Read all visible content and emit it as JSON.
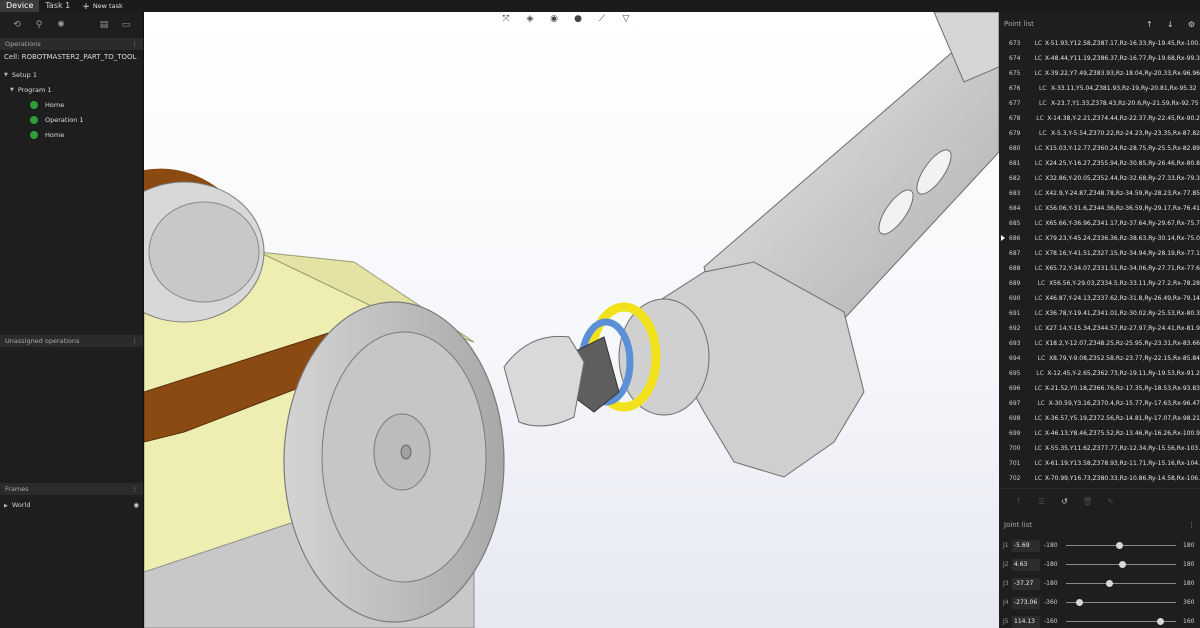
{
  "topbar": {
    "tabs": [
      {
        "label": "Device"
      },
      {
        "label": "Task 1"
      }
    ],
    "new_task": "New task"
  },
  "left": {
    "operations_title": "Operations",
    "cell": "Cell: ROBOTMASTER2_PART_TO_TOOL",
    "setup": "Setup 1",
    "program": "Program 1",
    "items": [
      "Home",
      "Operation 1",
      "Home"
    ],
    "unassigned_title": "Unassigned operations",
    "frames_title": "Frames",
    "frames_item": "World"
  },
  "points": {
    "title": "Point list",
    "current": "686",
    "rows": [
      {
        "n": "673",
        "t": "LC",
        "c": "X-51.93,Y12.58,Z387.17,Rz-16.33,Ry-19.45,Rx-100."
      },
      {
        "n": "674",
        "t": "LC",
        "c": "X-48.44,Y11.19,Z386.37,Rz-16.77,Ry-19.68,Rx-99.3"
      },
      {
        "n": "675",
        "t": "LC",
        "c": "X-39.22,Y7.49,Z383.93,Rz-18.04,Ry-20.33,Rx-96.96"
      },
      {
        "n": "676",
        "t": "LC",
        "c": "X-33.11,Y5.04,Z381.93,Rz-19,Ry-20.81,Rx-95.32"
      },
      {
        "n": "677",
        "t": "LC",
        "c": "X-23.7,Y1.33,Z378.43,Rz-20.6,Ry-21.59,Rx-92.75"
      },
      {
        "n": "678",
        "t": "LC",
        "c": "X-14.38,Y-2.21,Z374.44,Rz-22.37,Ry-22.45,Rx-90.2"
      },
      {
        "n": "679",
        "t": "LC",
        "c": "X-5.3,Y-5.54,Z370.22,Rz-24.23,Ry-23.35,Rx-87.82"
      },
      {
        "n": "680",
        "t": "LC",
        "c": "X15.03,Y-12.77,Z360.24,Rz-28.75,Ry-25.5,Rx-82.89"
      },
      {
        "n": "681",
        "t": "LC",
        "c": "X24.25,Y-16.27,Z355.94,Rz-30.85,Ry-26.46,Rx-80.8"
      },
      {
        "n": "682",
        "t": "LC",
        "c": "X32.86,Y-20.05,Z352.44,Rz-32.68,Ry-27.33,Rx-79.3"
      },
      {
        "n": "683",
        "t": "LC",
        "c": "X42.9,Y-24.87,Z348.78,Rz-34.59,Ry-28.23,Rx-77.85"
      },
      {
        "n": "684",
        "t": "LC",
        "c": "X56.06,Y-31.6,Z344.36,Rz-36.59,Ry-29.17,Rx-76.41"
      },
      {
        "n": "685",
        "t": "LC",
        "c": "X65.66,Y-36.96,Z341.17,Rz-37.64,Ry-29.67,Rx-75.7"
      },
      {
        "n": "686",
        "t": "LC",
        "c": "X79.23,Y-45.24,Z336.36,Rz-38.63,Ry-30.14,Rx-75.0"
      },
      {
        "n": "687",
        "t": "LC",
        "c": "X78.16,Y-41.51,Z327.15,Rz-34.94,Ry-28.19,Rx-77.1"
      },
      {
        "n": "688",
        "t": "LC",
        "c": "X65.72,Y-34.07,Z331.51,Rz-34.06,Ry-27.71,Rx-77.6"
      },
      {
        "n": "689",
        "t": "LC",
        "c": "X56.56,Y-29.03,Z334.5,Rz-33.11,Ry-27.2,Rx-78.28"
      },
      {
        "n": "690",
        "t": "LC",
        "c": "X46.87,Y-24.13,Z337.62,Rz-31.8,Ry-26.49,Rx-79.14"
      },
      {
        "n": "691",
        "t": "LC",
        "c": "X36.78,Y-19.41,Z341.01,Rz-30.02,Ry-25.53,Rx-80.3"
      },
      {
        "n": "692",
        "t": "LC",
        "c": "X27.14,Y-15.34,Z344.57,Rz-27.97,Ry-24.41,Rx-81.9"
      },
      {
        "n": "693",
        "t": "LC",
        "c": "X18.2,Y-12.07,Z348.25,Rz-25.95,Ry-23.31,Rx-83.66"
      },
      {
        "n": "694",
        "t": "LC",
        "c": "X8.79,Y-9.08,Z352.58,Rz-23.77,Ry-22.15,Rx-85.84"
      },
      {
        "n": "695",
        "t": "LC",
        "c": "X-12.45,Y-2.65,Z362.73,Rz-19.11,Ry-19.53,Rx-91.2"
      },
      {
        "n": "696",
        "t": "LC",
        "c": "X-21.52,Y0.18,Z366.76,Rz-17.35,Ry-18.53,Rx-93.83"
      },
      {
        "n": "697",
        "t": "LC",
        "c": "X-30.59,Y3.16,Z370.4,Rz-15.77,Ry-17.63,Rx-96.47"
      },
      {
        "n": "698",
        "t": "LC",
        "c": "X-36.57,Y5.19,Z372.56,Rz-14.81,Ry-17.07,Rx-98.21"
      },
      {
        "n": "699",
        "t": "LC",
        "c": "X-46.13,Y8.46,Z375.52,Rz-13.46,Ry-16.26,Rx-100.9"
      },
      {
        "n": "700",
        "t": "LC",
        "c": "X-55.35,Y11.62,Z377.77,Rz-12.34,Ry-15.56,Rx-103."
      },
      {
        "n": "701",
        "t": "LC",
        "c": "X-61.19,Y13.58,Z378.93,Rz-11.71,Ry-15.16,Rx-104."
      },
      {
        "n": "702",
        "t": "LC",
        "c": "X-70.99,Y16.73,Z380.33,Rz-10.86,Ry-14.58,Rx-106."
      }
    ]
  },
  "joints": {
    "title": "Joint list",
    "rows": [
      {
        "name": "J1",
        "value": "-5.69",
        "min": "-180",
        "max": "180",
        "level": 0.484
      },
      {
        "name": "J2",
        "value": "4.63",
        "min": "-180",
        "max": "180",
        "level": 0.513
      },
      {
        "name": "J3",
        "value": "-37.27",
        "min": "-180",
        "max": "180",
        "level": 0.397
      },
      {
        "name": "J4",
        "value": "-273.06",
        "min": "-360",
        "max": "360",
        "level": 0.121
      },
      {
        "name": "J5",
        "value": "114.13",
        "min": "-160",
        "max": "160",
        "level": 0.857
      }
    ]
  },
  "colors": {
    "accent_green": "#2e9e3a",
    "ring_yellow": "#f2e21b",
    "ring_blue": "#5b8fd6",
    "belt_brown": "#8a4a12",
    "part_yellow": "#f0efb4"
  },
  "icons": [
    "cursor-icon",
    "magnet-icon",
    "gear-icon",
    "file-icon",
    "monitor-icon",
    "arrow-up-icon",
    "arrow-down-icon",
    "settings-icon",
    "undo-icon"
  ]
}
